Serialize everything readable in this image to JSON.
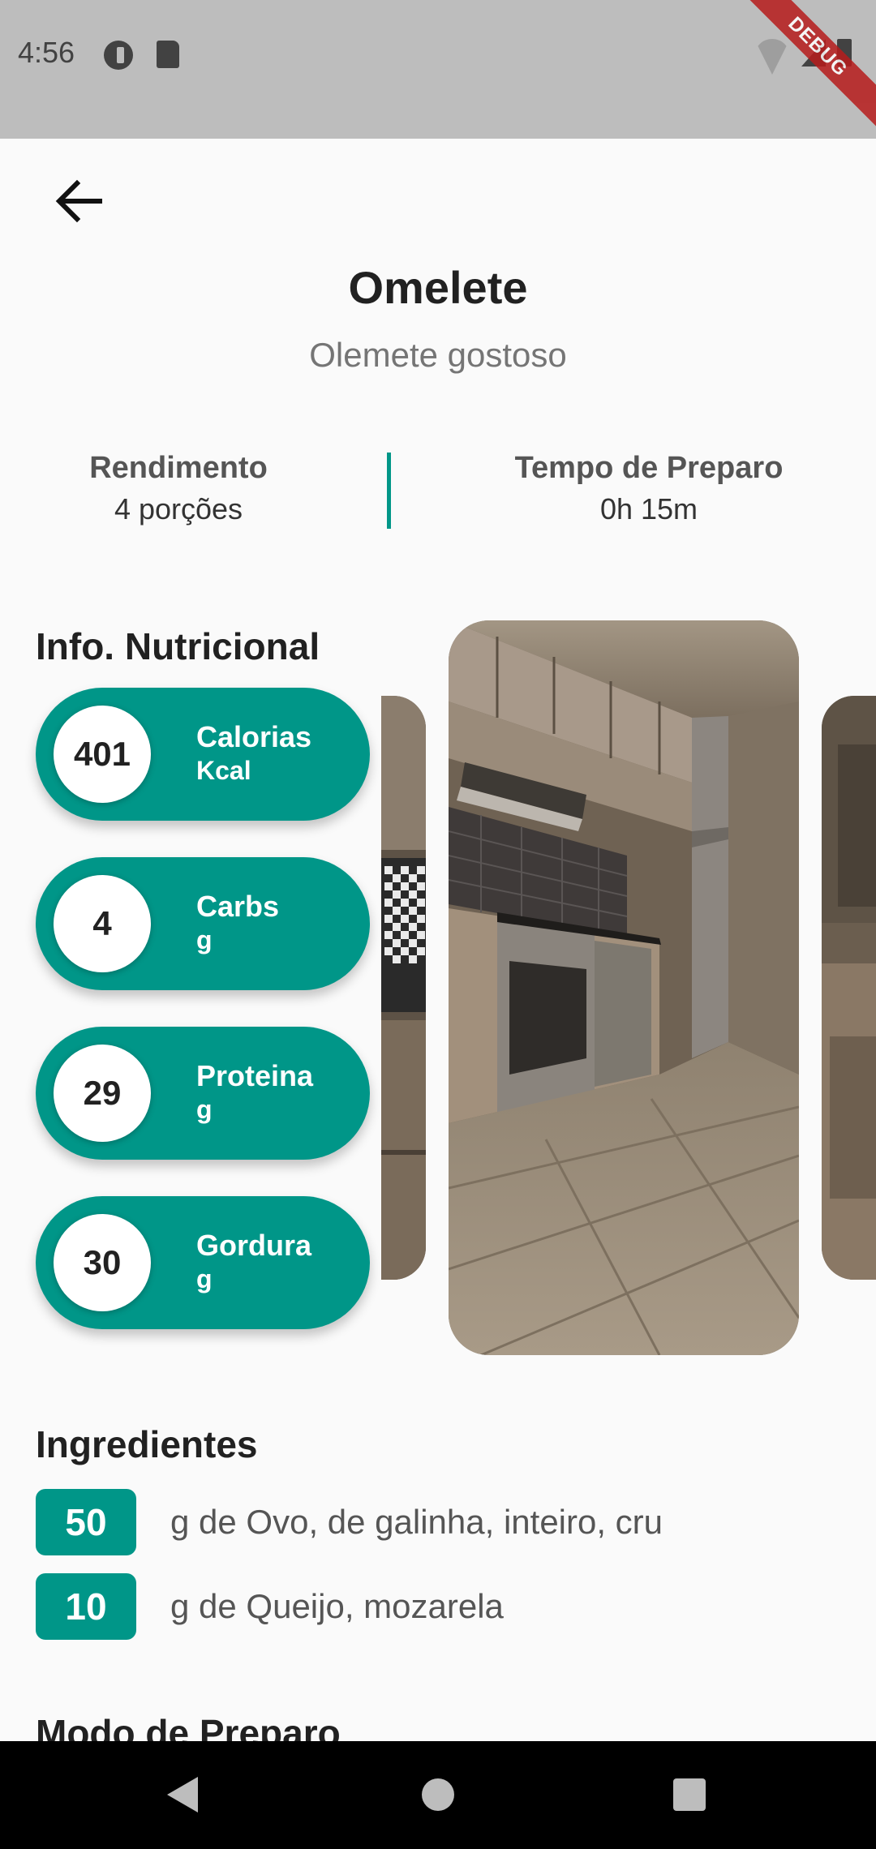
{
  "status_bar": {
    "time": "4:56",
    "debug_label": "DEBUG"
  },
  "recipe": {
    "title": "Omelete",
    "subtitle": "Olemete gostoso",
    "yield_label": "Rendimento",
    "yield_value": "4 porções",
    "time_label": "Tempo de Preparo",
    "time_value": "0h 15m"
  },
  "nutrition": {
    "title": "Info. Nutricional",
    "items": [
      {
        "value": "401",
        "name": "Calorias",
        "unit": "Kcal"
      },
      {
        "value": "4",
        "name": "Carbs",
        "unit": "g"
      },
      {
        "value": "29",
        "name": "Proteina",
        "unit": "g"
      },
      {
        "value": "30",
        "name": "Gordura",
        "unit": "g"
      }
    ]
  },
  "ingredients": {
    "title": "Ingredientes",
    "items": [
      {
        "qty": "50",
        "text": "g de Ovo, de galinha, inteiro, cru"
      },
      {
        "qty": "10",
        "text": "g de Queijo, mozarela"
      }
    ]
  },
  "preparation": {
    "title": "Modo de Preparo"
  },
  "icons": {
    "back": "arrow-left-icon",
    "nav_back": "triangle-back-icon",
    "nav_home": "circle-home-icon",
    "nav_recents": "square-recents-icon"
  },
  "colors": {
    "accent": "#009688",
    "status_bar": "#bdbdbd",
    "background": "#fafafa"
  }
}
